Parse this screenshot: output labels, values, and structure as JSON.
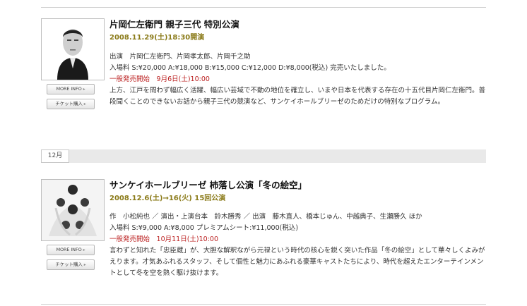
{
  "buttons": {
    "more_info": "MORE INFO",
    "ticket": "チケット購入",
    "arrow": "▸"
  },
  "events": [
    {
      "title": "片岡仁左衛門 親子三代 特別公演",
      "date": "2008.11.29(土)18:30開演",
      "cast": "出演　片岡仁左衛門、片岡孝太郎、片岡千之助",
      "price": "入場料 S:¥20,000 A:¥18,000 B:¥15,000 C:¥12,000 D:¥8,000(税込) 完売いたしました。",
      "sale_label": "一般発売開始",
      "sale_date": "9月6日(土)10:00",
      "description": "上方、江戸を問わず幅広く活躍、幅広い芸域で不動の地位を確立し、いまや日本を代表する存在の十五代目片岡仁左衛門。普段聞くことのできないお話から親子三代の競演など、サンケイホールブリーゼのためだけの特別なプログラム。"
    },
    {
      "title": "サンケイホールブリーゼ 杮落し公演「冬の絵空」",
      "date": "2008.12.6(土)→16(火) 15回公演",
      "cast": "作　小松純也 ／ 演出・上演台本　鈴木勝秀 ／ 出演　藤木直人、橋本じゅん、中越典子、生瀬勝久 ほか",
      "price": "入場料 S:¥9,000 A:¥8,000 プレミアムシート:¥11,000(税込)",
      "sale_label": "一般発売開始",
      "sale_date": "10月11日(土)10:00",
      "description": "言わずと知れた「忠臣蔵」が、大胆な解釈ながら元禄という時代の核心を鋭く突いた作品「冬の絵空」として華々しくよみがえります。才気あふれるスタッフ、そして個性と魅力にあふれる豪華キャストたちにより、時代を超えたエンターテインメントとして冬を空を熱く駆け抜けます。"
    }
  ],
  "month_label": "12月",
  "colors": {
    "date": "#8a7a18",
    "sale": "#bb2020",
    "divider": "#cfcfcf",
    "month_bar": "#e9e9e9"
  }
}
